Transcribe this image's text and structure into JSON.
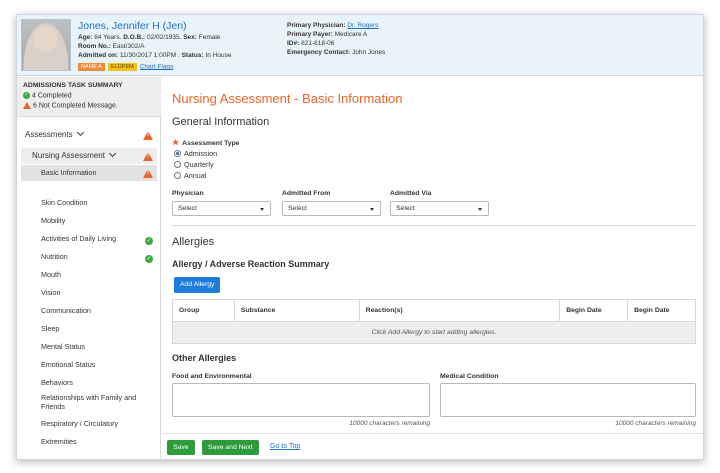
{
  "patient": {
    "name": "Jones, Jennifer H (Jen)",
    "age_label": "Age:",
    "age": "84 Years.",
    "dob_label": "D.O.B.:",
    "dob": "02/02/1935.",
    "sex_label": "Sex:",
    "sex": "Female",
    "room_label": "Room No.:",
    "room": "East/302/A",
    "admitted_label": "Admitted on:",
    "admitted": "11/30/2017 1:00PM .",
    "status_label": "Status:",
    "status": "In House",
    "flags": [
      "NAME A",
      "ELOPEM"
    ],
    "flags_link": "Chart Flags",
    "primary_physician_label": "Primary Physician:",
    "primary_physician": "Dr. Rogers",
    "primary_payer_label": "Primary Payer:",
    "primary_payer": "Medicare A",
    "id_label": "ID#:",
    "id": "821-618-06",
    "emergency_label": "Emergency Contact:",
    "emergency": "John Jones"
  },
  "summary": {
    "title": "ADMISSIONS TASK SUMMARY",
    "completed": "4 Completed",
    "not_completed": "6 Not Completed Message."
  },
  "nav": {
    "section": "Assessments",
    "subsection": "Nursing Assessment",
    "items": [
      {
        "label": "Basic Information",
        "status": "warn"
      },
      {
        "label": "Skin Condition",
        "status": ""
      },
      {
        "label": "Mobility",
        "status": ""
      },
      {
        "label": "Activities of Daily Living",
        "status": "ok"
      },
      {
        "label": "Nutrition",
        "status": "ok"
      },
      {
        "label": "Mouth",
        "status": ""
      },
      {
        "label": "Vision",
        "status": ""
      },
      {
        "label": "Communication",
        "status": ""
      },
      {
        "label": "Sleep",
        "status": ""
      },
      {
        "label": "Mental Status",
        "status": ""
      },
      {
        "label": "Emotional Status",
        "status": ""
      },
      {
        "label": "Behaviors",
        "status": ""
      },
      {
        "label": "Relationships with Family and Friends",
        "status": ""
      },
      {
        "label": "Respiratory / Circulatory",
        "status": ""
      },
      {
        "label": "Extremities",
        "status": ""
      }
    ]
  },
  "main": {
    "title": "Nursing Assessment - Basic Information",
    "general_title": "General Information",
    "assessment_type_label": "Assessment Type",
    "assessment_types": [
      "Admission",
      "Quarterly",
      "Annual"
    ],
    "assessment_type_selected": "Admission",
    "physician_label": "Physician",
    "physician_value": "Select",
    "admitted_from_label": "Admitted From",
    "admitted_from_value": "Select",
    "admitted_via_label": "Admitted Via",
    "admitted_via_value": "Select",
    "allergies_title": "Allergies",
    "summary_title": "Allergy / Adverse Reaction Summary",
    "add_allergy": "Add Allergy",
    "table_headers": [
      "Group",
      "Substance",
      "Reaction(s)",
      "Begin Date",
      "Begin Date"
    ],
    "table_empty": "Click Add Allergy to start adding allergies.",
    "other_title": "Other Allergies",
    "food_label": "Food and Environmental",
    "medical_label": "Medical Condition",
    "food_remaining": "10000 characters remaining",
    "medical_remaining": "10000 characters remaining"
  },
  "footer": {
    "save": "Save",
    "save_next": "Save and Next",
    "go_top": "Go to Top"
  },
  "colors": {
    "accent": "#e8662b",
    "link": "#1e6fbf",
    "primary_button": "#1f7bd9",
    "save_button": "#2f9a3c"
  }
}
